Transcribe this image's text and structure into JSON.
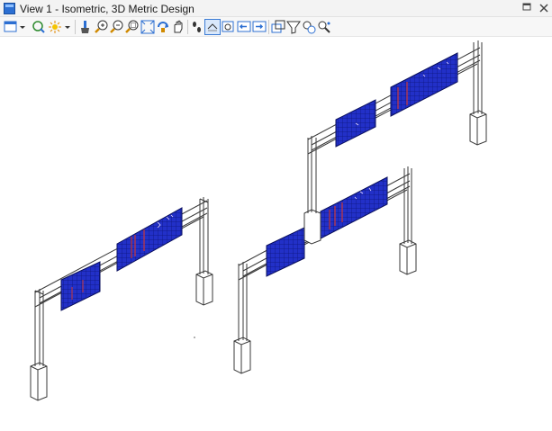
{
  "window": {
    "title": "View 1 - Isometric, 3D Metric Design"
  },
  "toolbar": {
    "tools": [
      {
        "name": "view-attributes-icon",
        "has_dropdown": true
      },
      {
        "name": "view-display-mode-icon"
      },
      {
        "name": "lighting-icon",
        "has_dropdown": true
      },
      {
        "name": "clear-brush-icon"
      },
      {
        "name": "zoom-in-icon"
      },
      {
        "name": "zoom-out-icon"
      },
      {
        "name": "window-area-icon"
      },
      {
        "name": "fit-view-icon"
      },
      {
        "name": "rotate-view-icon"
      },
      {
        "name": "pan-view-icon"
      },
      {
        "name": "walk-icon"
      },
      {
        "name": "view-previous-icon"
      },
      {
        "name": "view-next-icon"
      },
      {
        "name": "copy-view-icon"
      },
      {
        "name": "clip-volume-icon"
      },
      {
        "name": "clip-mask-icon"
      },
      {
        "name": "camera-icon"
      },
      {
        "name": "section-icon"
      }
    ]
  },
  "colors": {
    "sign_panel": "#2230c8",
    "sign_grid": "#0c157a",
    "sign_marks": "#c8383a",
    "structure_line": "#3a3a3a",
    "accent": "#3b7bd4"
  }
}
